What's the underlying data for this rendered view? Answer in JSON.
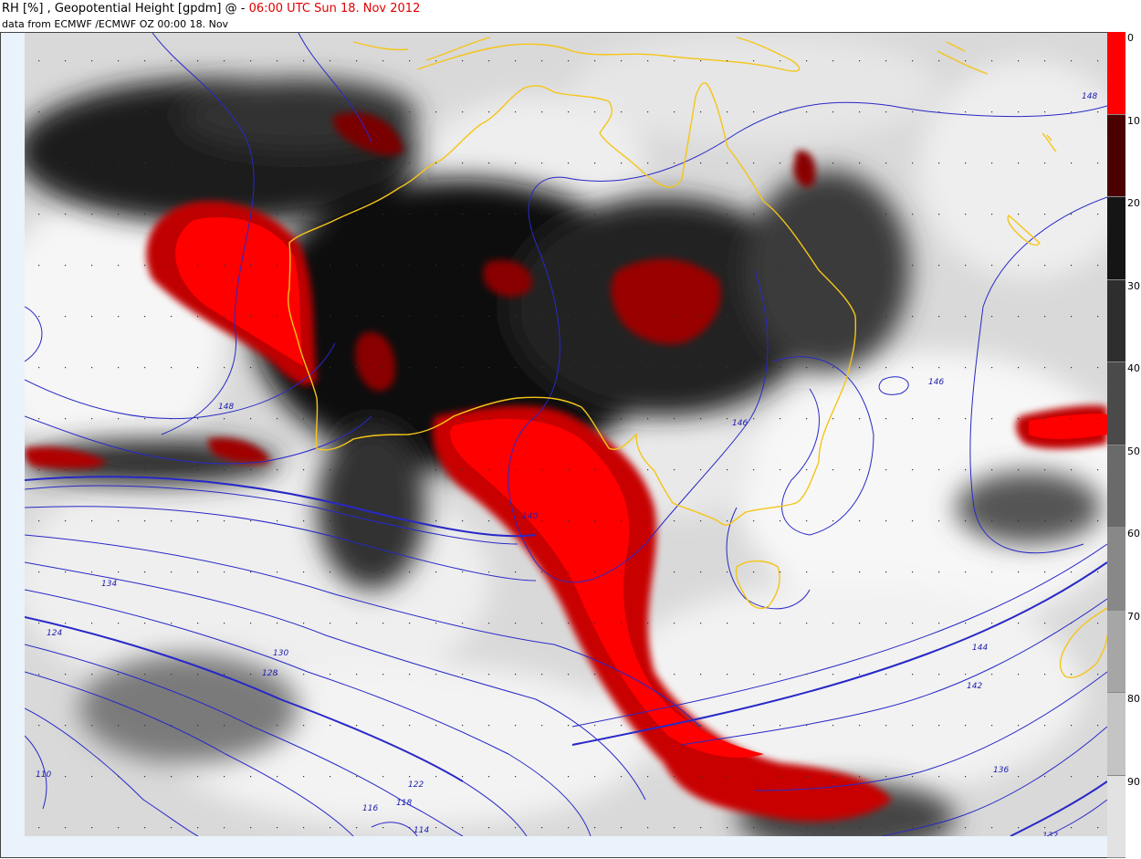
{
  "header": {
    "title_prefix": "RH [%] , Geopotential Height [gpdm] @ - ",
    "title_time": "06:00 UTC Sun 18. Nov 2012",
    "subtitle": "data from ECMWF /ECMWF OZ 00:00 18. Nov"
  },
  "legend": {
    "bins": [
      {
        "label": "0",
        "color": "#ff0000"
      },
      {
        "label": "10",
        "color": "#4a0000"
      },
      {
        "label": "20",
        "color": "#151515"
      },
      {
        "label": "30",
        "color": "#2e2e2e"
      },
      {
        "label": "40",
        "color": "#4a4a4a"
      },
      {
        "label": "50",
        "color": "#6a6a6a"
      },
      {
        "label": "60",
        "color": "#888888"
      },
      {
        "label": "70",
        "color": "#a6a6a6"
      },
      {
        "label": "80",
        "color": "#c4c4c4"
      },
      {
        "label": "90",
        "color": "#e2e2e2"
      }
    ]
  },
  "contour_labels": [
    "148",
    "148",
    "146",
    "146",
    "144",
    "142",
    "140",
    "134",
    "130",
    "128",
    "124",
    "122",
    "118",
    "116",
    "114",
    "110",
    "136",
    "132"
  ],
  "colors": {
    "coast": "#f5c518",
    "contour": "#2828c8",
    "dry": "#d80000"
  }
}
